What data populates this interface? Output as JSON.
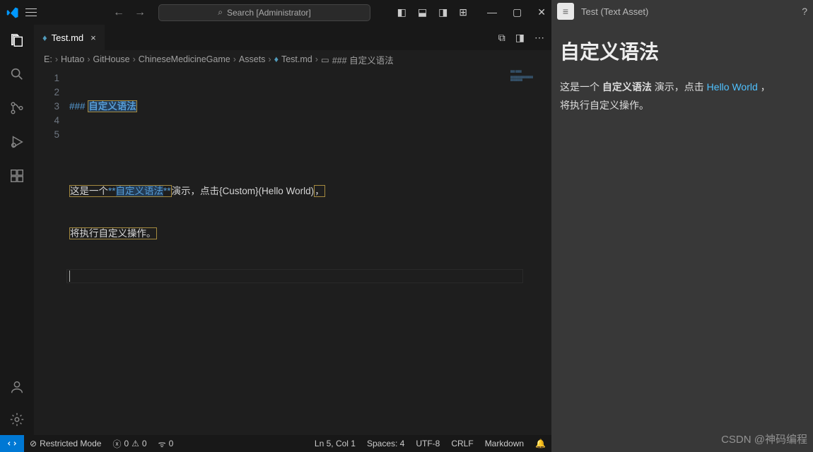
{
  "titlebar": {
    "search_placeholder": "Search [Administrator]"
  },
  "tab": {
    "filename": "Test.md",
    "close": "×"
  },
  "breadcrumbs": {
    "parts": [
      "E:",
      "Hutao",
      "GitHouse",
      "ChineseMedicineGame",
      "Assets",
      "Test.md",
      "### 自定义语法"
    ],
    "sep": "›"
  },
  "editor": {
    "lines": [
      "1",
      "2",
      "3",
      "4",
      "5"
    ],
    "l1_hash": "### ",
    "l1_title": "自定义语法",
    "l3_a": "这是一个",
    "l3_star": "**",
    "l3_b": "自定义语法",
    "l3_c": "演示，点击",
    "l3_d": "{Custom}(Hello World)",
    "l3_e": "，",
    "l4": "将执行自定义操作。"
  },
  "statusbar": {
    "restricted": "Restricted Mode",
    "errors": "0",
    "warnings": "0",
    "ports": "0",
    "lncol": "Ln 5, Col 1",
    "spaces": "Spaces: 4",
    "encoding": "UTF-8",
    "eol": "CRLF",
    "lang": "Markdown"
  },
  "preview": {
    "header": "Test (Text Asset)",
    "title": "自定义语法",
    "p_a": "这是一个 ",
    "p_bold": "自定义语法",
    "p_b": " 演示，点击 ",
    "p_link": "Hello World",
    "p_c": " ，",
    "p_d": "将执行自定义操作。"
  },
  "watermark": "CSDN @神码编程"
}
